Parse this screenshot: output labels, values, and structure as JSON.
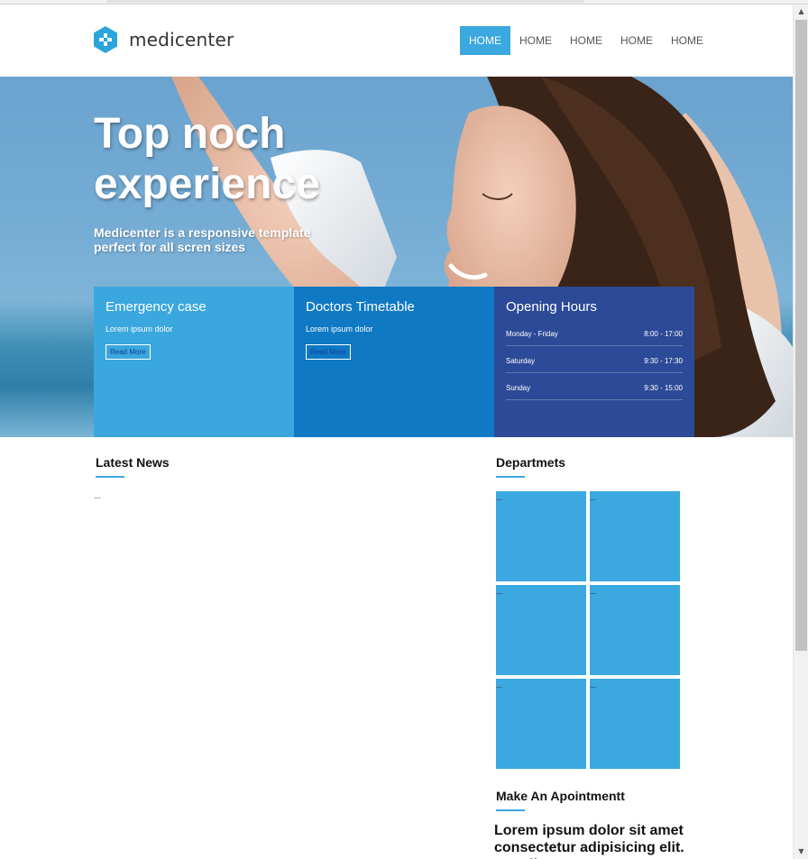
{
  "header": {
    "logo_text": "medicenter",
    "nav": [
      {
        "label": "HOME",
        "active": true
      },
      {
        "label": "HOME",
        "active": false
      },
      {
        "label": "HOME",
        "active": false
      },
      {
        "label": "HOME",
        "active": false
      },
      {
        "label": "HOME",
        "active": false
      }
    ]
  },
  "hero": {
    "title": "Top noch experience",
    "subtitle": "Medicenter is a responsive template perfect for all scren sizes"
  },
  "boxes": {
    "emergency": {
      "title": "Emergency case",
      "text": "Lorem ipsum dolor",
      "button": "Read More"
    },
    "timetable": {
      "title": "Doctors Timetable",
      "text": "Lorem ipsum dolor",
      "button": "Read More"
    },
    "hours": {
      "title": "Opening Hours",
      "rows": [
        {
          "day": "Monday - Friday",
          "time": "8:00 - 17:00"
        },
        {
          "day": "Saturday",
          "time": "9:30 - 17:30"
        },
        {
          "day": "Sunday",
          "time": "9:30 - 15:00"
        }
      ]
    }
  },
  "news": {
    "title": "Latest News",
    "placeholder": "..."
  },
  "departments": {
    "title": "Departmets",
    "tiles": [
      "...",
      "...",
      "...",
      "...",
      "...",
      "..."
    ]
  },
  "appointment": {
    "title": "Make An Apointmentt",
    "text": "Lorem ipsum dolor sit amet consectetur adipisicing elit. Repellat"
  },
  "colors": {
    "accent": "#3ba8e0",
    "timetable_blue": "#0f79c4",
    "hours_navy": "#2c4a97"
  },
  "icons": {
    "logo": "medical-cross-hexagon-icon"
  }
}
